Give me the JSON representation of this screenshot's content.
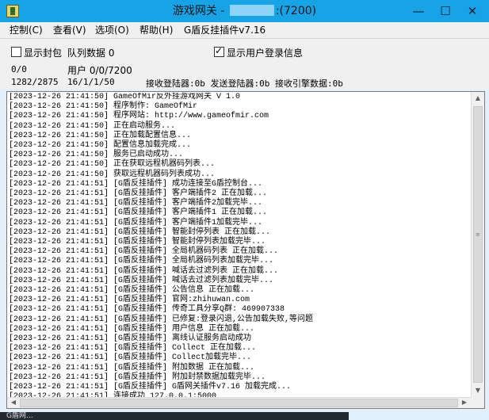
{
  "window": {
    "title_prefix": "游戏网关 - ",
    "title_suffix": ":(7200)",
    "minimize_glyph": "—",
    "maximize_glyph": "☐",
    "close_glyph": "✕"
  },
  "menu": [
    "控制(C)",
    "查看(V)",
    "选项(O)",
    "帮助(H)",
    "G盾反挂插件v7.16"
  ],
  "panel": {
    "show_packets": {
      "label": "显示封包",
      "checked": false
    },
    "queue_label": "队列数据 0",
    "show_login": {
      "label": "显示用户登录信息",
      "checked": true
    },
    "stat1": "0/0",
    "stat2": "用户 0/0/7200",
    "stat3": "1282/2875",
    "stat4": "16/1/1/50",
    "stat5": "接收登陆器:0b 发送登陆器:0b 接收引擎数据:0b"
  },
  "log": [
    "[2023-12-26 21:41:50] GameOfMir反外挂游戏网关 V 1.0",
    "[2023-12-26 21:41:50] 程序制作: GameOfMir",
    "[2023-12-26 21:41:50] 程序网站: http://www.gameofmir.com",
    "[2023-12-26 21:41:50] 正在启动服务...",
    "[2023-12-26 21:41:50] 正在加载配置信息...",
    "[2023-12-26 21:41:50] 配置信息加载完成...",
    "[2023-12-26 21:41:50] 服务已启动成功...",
    "[2023-12-26 21:41:50] 正在获取远程机器码列表...",
    "[2023-12-26 21:41:50] 获取远程机器码列表成功...",
    "[2023-12-26 21:41:51] [G盾反挂插件] 成功连接至G盾控制台...",
    "[2023-12-26 21:41:51] [G盾反挂插件] 客户端插件2 正在加载...",
    "[2023-12-26 21:41:51] [G盾反挂插件] 客户端插件2加载完毕...",
    "[2023-12-26 21:41:51] [G盾反挂插件] 客户端插件1 正在加载...",
    "[2023-12-26 21:41:51] [G盾反挂插件] 客户端插件1加载完毕...",
    "[2023-12-26 21:41:51] [G盾反挂插件] 智能封停列表 正在加载...",
    "[2023-12-26 21:41:51] [G盾反挂插件] 智能封停列表加载完毕...",
    "[2023-12-26 21:41:51] [G盾反挂插件] 全局机器码列表 正在加载...",
    "[2023-12-26 21:41:51] [G盾反挂插件] 全局机器码列表加载完毕...",
    "[2023-12-26 21:41:51] [G盾反挂插件] 喊话去过滤列表 正在加载...",
    "[2023-12-26 21:41:51] [G盾反挂插件] 喊话去过滤列表加载完毕...",
    "[2023-12-26 21:41:51] [G盾反挂插件] 公告信息 正在加载...",
    "[2023-12-26 21:41:51] [G盾反挂插件] 官网:zhihuwan.com",
    "[2023-12-26 21:41:51] [G盾反挂插件] 传奇工具分享Q群: 469907338",
    "[2023-12-26 21:41:51] [G盾反挂插件] 已修复:登录闪退,公告加载失败,等问题",
    "[2023-12-26 21:41:51] [G盾反挂插件] 用户信息 正在加载...",
    "[2023-12-26 21:41:51] [G盾反挂插件] 离线认证服务启动成功",
    "[2023-12-26 21:41:51] [G盾反挂插件] Collect 正在加载...",
    "[2023-12-26 21:41:51] [G盾反挂插件] Collect加载完毕...",
    "[2023-12-26 21:41:51] [G盾反挂插件] 附加数据 正在加载...",
    "[2023-12-26 21:41:51] [G盾反挂插件] 附加封禁数据加载完毕...",
    "[2023-12-26 21:41:51] [G盾反挂插件] G盾网关插件v7.16 加载完成...",
    "[2023-12-26 21:41:51] 连接成功 127.0.0.1:5000"
  ],
  "taskbar_label": "G盾网..."
}
